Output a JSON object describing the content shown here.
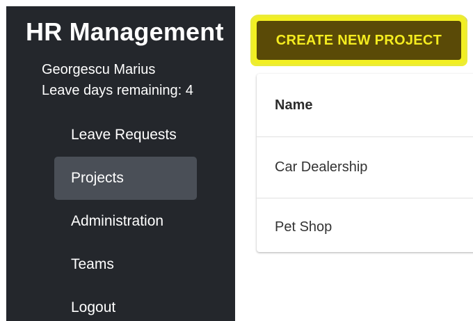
{
  "sidebar": {
    "app_title": "HR Management",
    "user_name": "Georgescu Marius",
    "leave_days": "Leave days remaining: 4",
    "nav_items": [
      {
        "label": "Leave Requests",
        "active": false
      },
      {
        "label": "Projects",
        "active": true
      },
      {
        "label": "Administration",
        "active": false
      },
      {
        "label": "Teams",
        "active": false
      },
      {
        "label": "Logout",
        "active": false
      }
    ]
  },
  "main": {
    "create_button_label": "CREATE NEW PROJECT",
    "table": {
      "header": "Name",
      "rows": [
        "Car Dealership",
        "Pet Shop"
      ]
    }
  },
  "colors": {
    "sidebar_bg": "#24272c",
    "nav_active_bg": "#4a4f57",
    "button_bg": "#5a4a07",
    "button_text": "#f5ec1f",
    "highlight": "#f6f224"
  }
}
